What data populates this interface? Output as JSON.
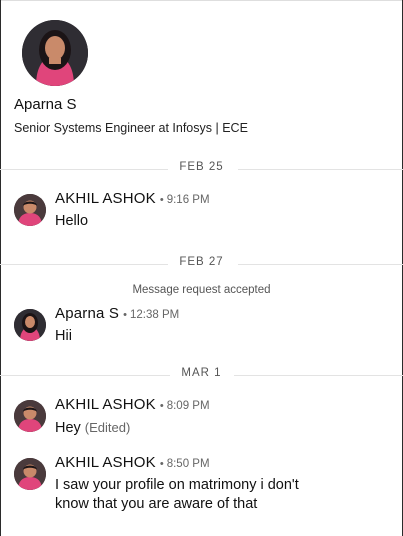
{
  "profile": {
    "name": "Aparna S",
    "headline": "Senior Systems Engineer at Infosys | ECE"
  },
  "thread": {
    "date1": "FEB 25",
    "date2": "FEB 27",
    "date3": "MAR 1",
    "request_note": "Message request accepted",
    "messages": [
      {
        "sender": "AKHIL ASHOK",
        "time": "9:16 PM",
        "text": "Hello"
      },
      {
        "sender": "Aparna S",
        "time": "12:38 PM",
        "text": "Hii"
      },
      {
        "sender": "AKHIL ASHOK",
        "time": "8:09 PM",
        "text": "Hey",
        "edited": "(Edited)"
      },
      {
        "sender": "AKHIL ASHOK",
        "time": "8:50 PM",
        "text_line1": "I saw your profile on matrimony i don't",
        "text_line2": "know that you are aware of that"
      }
    ]
  },
  "colors": {
    "avatar_shirt_pink": "#e0457b",
    "avatar_skin": "#c98a6a"
  }
}
